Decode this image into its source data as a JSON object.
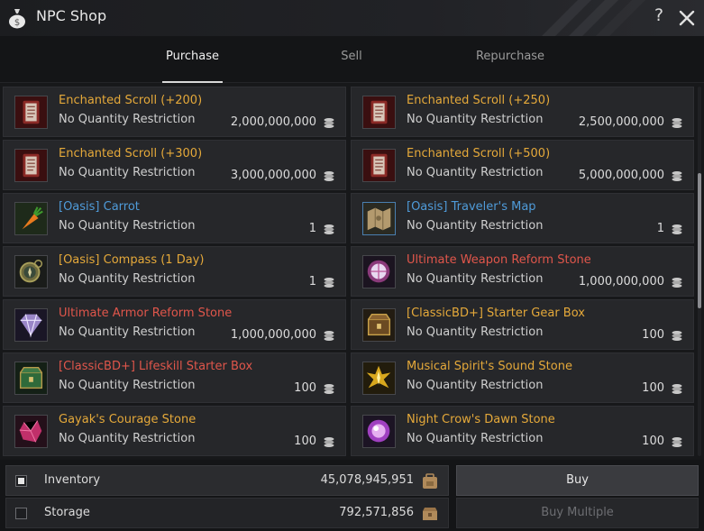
{
  "window": {
    "title": "NPC Shop"
  },
  "header": {
    "help_label": "?"
  },
  "tabs": [
    {
      "label": "Purchase",
      "active": true
    },
    {
      "label": "Sell",
      "active": false
    },
    {
      "label": "Repurchase",
      "active": false
    }
  ],
  "items": [
    {
      "name": "Enchanted Scroll (+200)",
      "restriction": "No Quantity Restriction",
      "price": "2,000,000,000",
      "name_color": "#e5a93a",
      "icon": "scroll-icon"
    },
    {
      "name": "Enchanted Scroll (+250)",
      "restriction": "No Quantity Restriction",
      "price": "2,500,000,000",
      "name_color": "#e5a93a",
      "icon": "scroll-icon"
    },
    {
      "name": "Enchanted Scroll (+300)",
      "restriction": "No Quantity Restriction",
      "price": "3,000,000,000",
      "name_color": "#e5a93a",
      "icon": "scroll-icon"
    },
    {
      "name": "Enchanted Scroll (+500)",
      "restriction": "No Quantity Restriction",
      "price": "5,000,000,000",
      "name_color": "#e5a93a",
      "icon": "scroll-icon"
    },
    {
      "name": "[Oasis] Carrot",
      "restriction": "No Quantity Restriction",
      "price": "1",
      "name_color": "#4f9bd9",
      "icon": "carrot-icon"
    },
    {
      "name": "[Oasis] Traveler's Map",
      "restriction": "No Quantity Restriction",
      "price": "1",
      "name_color": "#4f9bd9",
      "icon": "map-icon"
    },
    {
      "name": "[Oasis] Compass (1 Day)",
      "restriction": "No Quantity Restriction",
      "price": "1",
      "name_color": "#e5a93a",
      "icon": "compass-icon"
    },
    {
      "name": "Ultimate Weapon Reform Stone",
      "restriction": "No Quantity Restriction",
      "price": "1,000,000,000",
      "name_color": "#e0564b",
      "icon": "weapon-stone-icon"
    },
    {
      "name": "Ultimate Armor Reform Stone",
      "restriction": "No Quantity Restriction",
      "price": "1,000,000,000",
      "name_color": "#e0564b",
      "icon": "armor-stone-icon"
    },
    {
      "name": "[ClassicBD+] Starter Gear Box",
      "restriction": "No Quantity Restriction",
      "price": "100",
      "name_color": "#e5a93a",
      "icon": "gear-box-icon"
    },
    {
      "name": "[ClassicBD+] Lifeskill Starter Box",
      "restriction": "No Quantity Restriction",
      "price": "100",
      "name_color": "#e0564b",
      "icon": "lifeskill-box-icon"
    },
    {
      "name": "Musical Spirit's Sound Stone",
      "restriction": "No Quantity Restriction",
      "price": "100",
      "name_color": "#e5a93a",
      "icon": "sound-stone-icon"
    },
    {
      "name": "Gayak's Courage Stone",
      "restriction": "No Quantity Restriction",
      "price": "100",
      "name_color": "#e5a93a",
      "icon": "courage-stone-icon"
    },
    {
      "name": "Night Crow's Dawn Stone",
      "restriction": "No Quantity Restriction",
      "price": "100",
      "name_color": "#e5a93a",
      "icon": "dawn-stone-icon"
    }
  ],
  "scroll": {
    "position": 0.37
  },
  "wallets": [
    {
      "label": "Inventory",
      "amount": "45,078,945,951",
      "checked": true,
      "icon": "backpack-icon"
    },
    {
      "label": "Storage",
      "amount": "792,571,856",
      "checked": false,
      "icon": "storage-chest-icon"
    }
  ],
  "actions": {
    "buy_label": "Buy",
    "buy_multiple_label": "Buy Multiple"
  }
}
